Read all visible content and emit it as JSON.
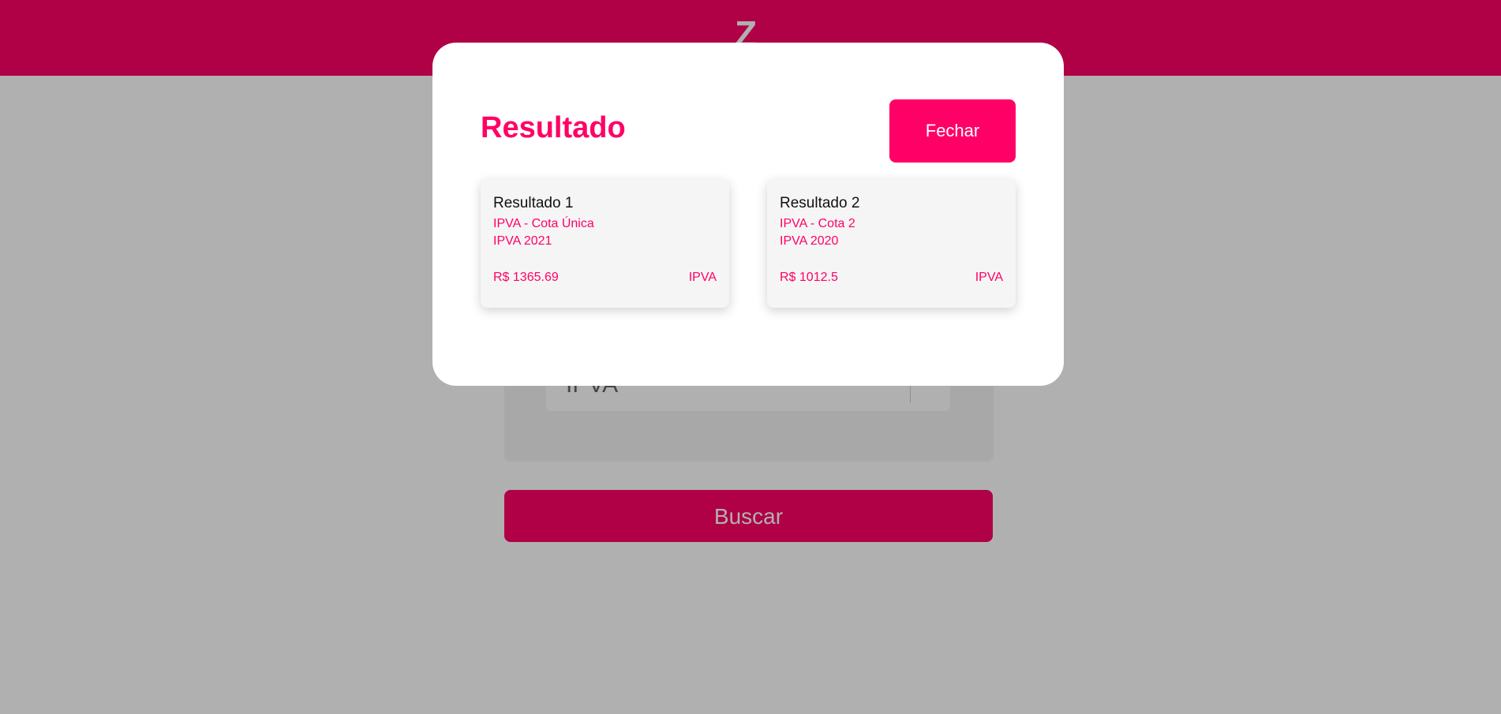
{
  "header": {
    "logo_text": "Z"
  },
  "search_form": {
    "service_select_value": "IPVA",
    "search_button_label": "Buscar"
  },
  "modal": {
    "title": "Resultado",
    "close_label": "Fechar",
    "results": [
      {
        "title": "Resultado 1",
        "description": "IPVA - Cota Única",
        "year_label": "IPVA 2021",
        "value": "R$ 1365.69",
        "type": "IPVA"
      },
      {
        "title": "Resultado 2",
        "description": "IPVA - Cota 2",
        "year_label": "IPVA 2020",
        "value": "R$ 1012.5",
        "type": "IPVA"
      }
    ]
  },
  "colors": {
    "brand": "#ff0066",
    "overlay": "rgba(0,0,0,0.31)",
    "card_background": "#f5f5f5"
  }
}
